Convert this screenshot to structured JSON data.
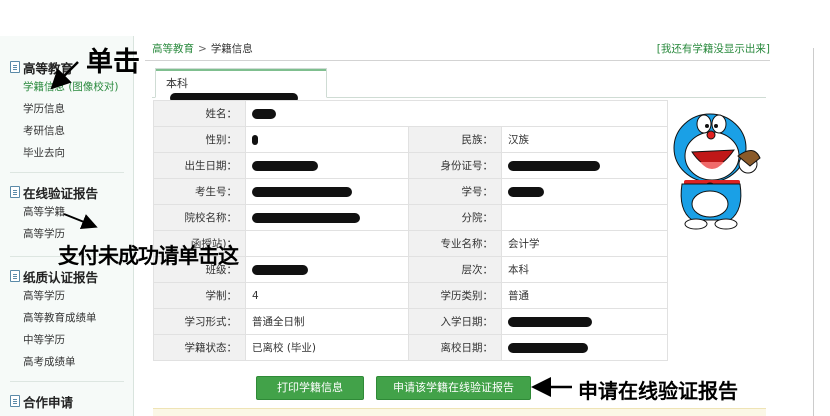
{
  "sidebar": {
    "groups": [
      {
        "title": "高等教育",
        "items": [
          "学籍信息 (图像校对)",
          "学历信息",
          "考研信息",
          "毕业去向"
        ]
      },
      {
        "title": "在线验证报告",
        "items": [
          "高等学籍",
          "高等学历"
        ]
      },
      {
        "title": "纸质认证报告",
        "items": [
          "高等学历",
          "高等教育成绩单",
          "中等学历",
          "高考成绩单"
        ]
      },
      {
        "title": "合作申请",
        "items": []
      }
    ]
  },
  "header": {
    "breadcrumb_home": "高等教育",
    "breadcrumb_sep": ">",
    "breadcrumb_current": "学籍信息",
    "missing_link": "[我还有学籍没显示出来]"
  },
  "tab": {
    "label": "本科"
  },
  "info": {
    "name_label": "姓名：",
    "gender_label": "性别：",
    "ethnicity_label": "民族：",
    "ethnicity_value": "汉族",
    "birth_label": "出生日期：",
    "id_label": "身份证号：",
    "exam_no_label": "考生号：",
    "student_no_label": "学号：",
    "school_label": "院校名称：",
    "branch_label": "分院：",
    "station_label": "函授站)：",
    "major_label": "专业名称：",
    "major_value": "会计学",
    "class_label": "班级：",
    "level_label": "层次：",
    "level_value": "本科",
    "duration_label": "学制：",
    "duration_value": "4",
    "category_label": "学历类别：",
    "category_value": "普通",
    "form_label": "学习形式：",
    "form_value": "普通全日制",
    "enroll_label": "入学日期：",
    "status_label": "学籍状态：",
    "status_value": "已离校 (毕业)",
    "leave_label": "离校日期："
  },
  "buttons": {
    "print": "打印学籍信息",
    "apply": "申请该学籍在线验证报告"
  },
  "annotations": {
    "click": "单击",
    "pay_fail": "支付未成功请单击这",
    "apply_report": "申请在线验证报告"
  },
  "colors": {
    "accent": "#42a249",
    "link": "#2a8a3e",
    "label_bg": "#f1f1f1"
  },
  "photo": {
    "icon": "doraemon-cartoon-photo"
  }
}
